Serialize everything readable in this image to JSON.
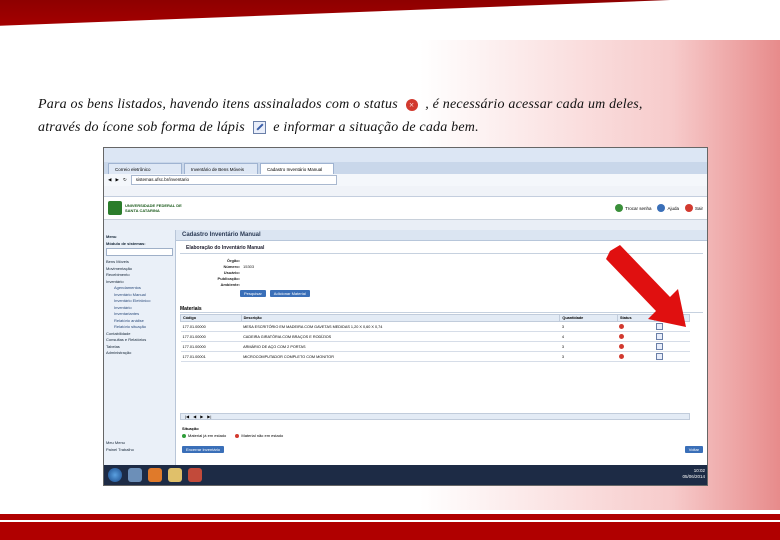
{
  "slide": {
    "caption_line1_before": "Para os bens listados, havendo itens assinalados com o status",
    "caption_line1_after": ", é necessário acessar cada um deles,",
    "caption_line2_before": "através do ícone sob forma de lápis",
    "caption_line2_after": "e informar a situação de cada bem.",
    "status_icon": "status-x-icon",
    "pencil_icon": "pencil-icon",
    "arrow_color": "#e01010",
    "accent": "#b00000"
  },
  "browser": {
    "tabs": [
      {
        "label": "Correio eletrônico"
      },
      {
        "label": "Inventário de Bens Móveis"
      },
      {
        "label": "Cadastro Inventário Manual"
      }
    ],
    "url": "sistemas.ufsc.br/inventario"
  },
  "app": {
    "logo_text": "UNIVERSIDADE FEDERAL DE SANTA CATARINA",
    "header_buttons": [
      {
        "label": "Trocar senha"
      },
      {
        "label": "Ajuda"
      },
      {
        "label": "Sair"
      }
    ],
    "sidebar": {
      "title_main": "Menu",
      "title_mod": "Módulo de sistemas:",
      "items": [
        {
          "label": "Bens Móveis",
          "sub": false
        },
        {
          "label": "Movimentação",
          "sub": false
        },
        {
          "label": "Recebimento",
          "sub": false
        },
        {
          "label": "Inventário",
          "sub": false
        },
        {
          "label": "Agendamentos",
          "sub": true
        },
        {
          "label": "Inventário Manual",
          "sub": true
        },
        {
          "label": "Inventário Eletrônico",
          "sub": true
        },
        {
          "label": "Inventário",
          "sub": true
        },
        {
          "label": "Inventariantes",
          "sub": true
        },
        {
          "label": "Relatório análise",
          "sub": true
        },
        {
          "label": "Relatório situação",
          "sub": true
        },
        {
          "label": "Contabilidade",
          "sub": false
        },
        {
          "label": "Consultas e Relatórios",
          "sub": false
        },
        {
          "label": "Tabelas",
          "sub": false
        },
        {
          "label": "Administração",
          "sub": false
        }
      ],
      "bottom_items": [
        {
          "label": "Meu Menu"
        },
        {
          "label": "Painel Trabalho"
        }
      ]
    },
    "panel_title": "Cadastro Inventário Manual",
    "section_title": "Elaboração do Inventário Manual",
    "form": [
      {
        "label": "Órgão:"
      },
      {
        "label": "Número:",
        "value": "15303"
      },
      {
        "label": "Usuário:"
      },
      {
        "label": "Publicação:"
      },
      {
        "label": "Ambiente:"
      }
    ],
    "buttons": {
      "search": "Pesquisar",
      "add": "Adicionar Material",
      "close_inventory": "Encerrar Inventário",
      "back": "Voltar"
    },
    "materials_title": "Materiais",
    "table": {
      "headers": [
        "Código",
        "Descrição",
        "Quantidade",
        "Status",
        "Editar"
      ],
      "rows": [
        {
          "code": "177.01.00000",
          "desc": "MESA ESCRITÓRIO EM MADEIRA COM GAVETAS MEDIDAS 1,20 X 0,60 X 0,74",
          "qty": "3"
        },
        {
          "code": "177.01.00000",
          "desc": "CADEIRA GIRATÓRIA COM BRAÇOS E RODÍZIOS",
          "qty": "4"
        },
        {
          "code": "177.01.00000",
          "desc": "ARMÁRIO DE AÇO COM 2 PORTAS",
          "qty": "3"
        },
        {
          "code": "177.01.00001",
          "desc": "MICROCOMPUTADOR COMPLETO COM MONITOR",
          "qty": "3"
        }
      ]
    },
    "situation": {
      "label": "Situação",
      "options": [
        {
          "label": "Material já em estado",
          "color": "#2f9e3a"
        },
        {
          "label": "Material não em estado",
          "color": "#d23a2f"
        }
      ]
    },
    "clock": {
      "time": "10:02",
      "date": "05/06/2014"
    }
  }
}
